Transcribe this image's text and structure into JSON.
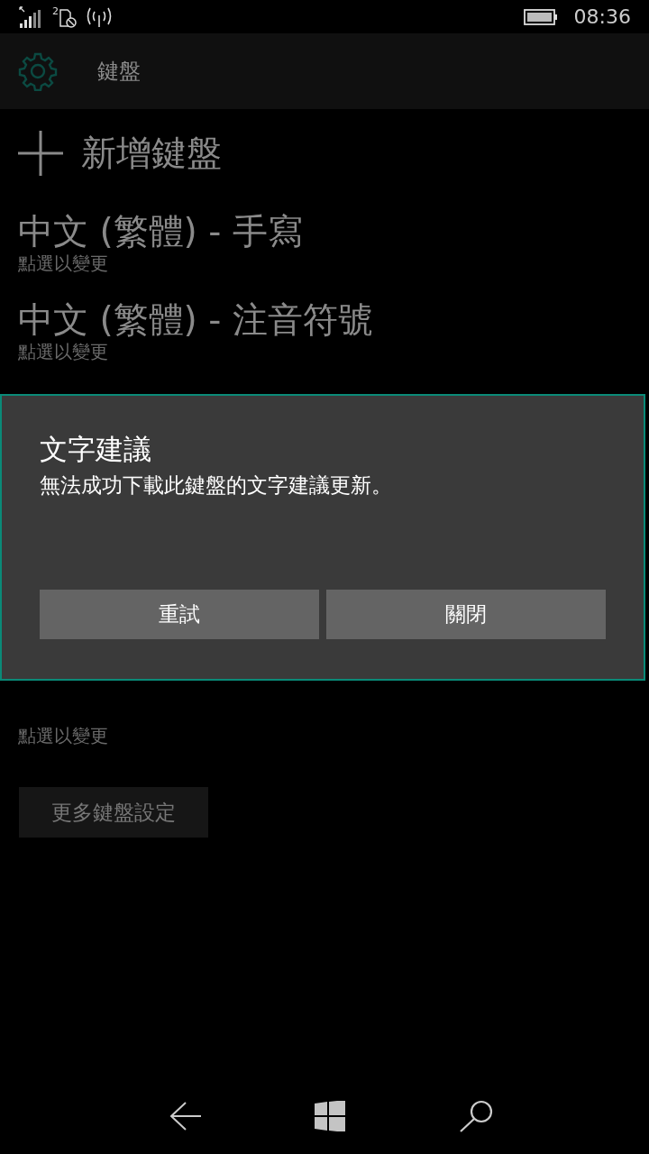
{
  "status_bar": {
    "sim_slot": "2",
    "time": "08:36"
  },
  "header": {
    "title": "鍵盤"
  },
  "add_keyboard": {
    "label": "新增鍵盤"
  },
  "keyboards": [
    {
      "name": "中文 (繁體) - 手寫",
      "hint": "點選以變更"
    },
    {
      "name": "中文 (繁體) - 注音符號",
      "hint": "點選以變更"
    },
    {
      "hint": "點選以變更"
    }
  ],
  "more_button": "更多鍵盤設定",
  "dialog": {
    "title": "文字建議",
    "message": "無法成功下載此鍵盤的文字建議更新。",
    "buttons": [
      "重試",
      "關閉"
    ]
  }
}
